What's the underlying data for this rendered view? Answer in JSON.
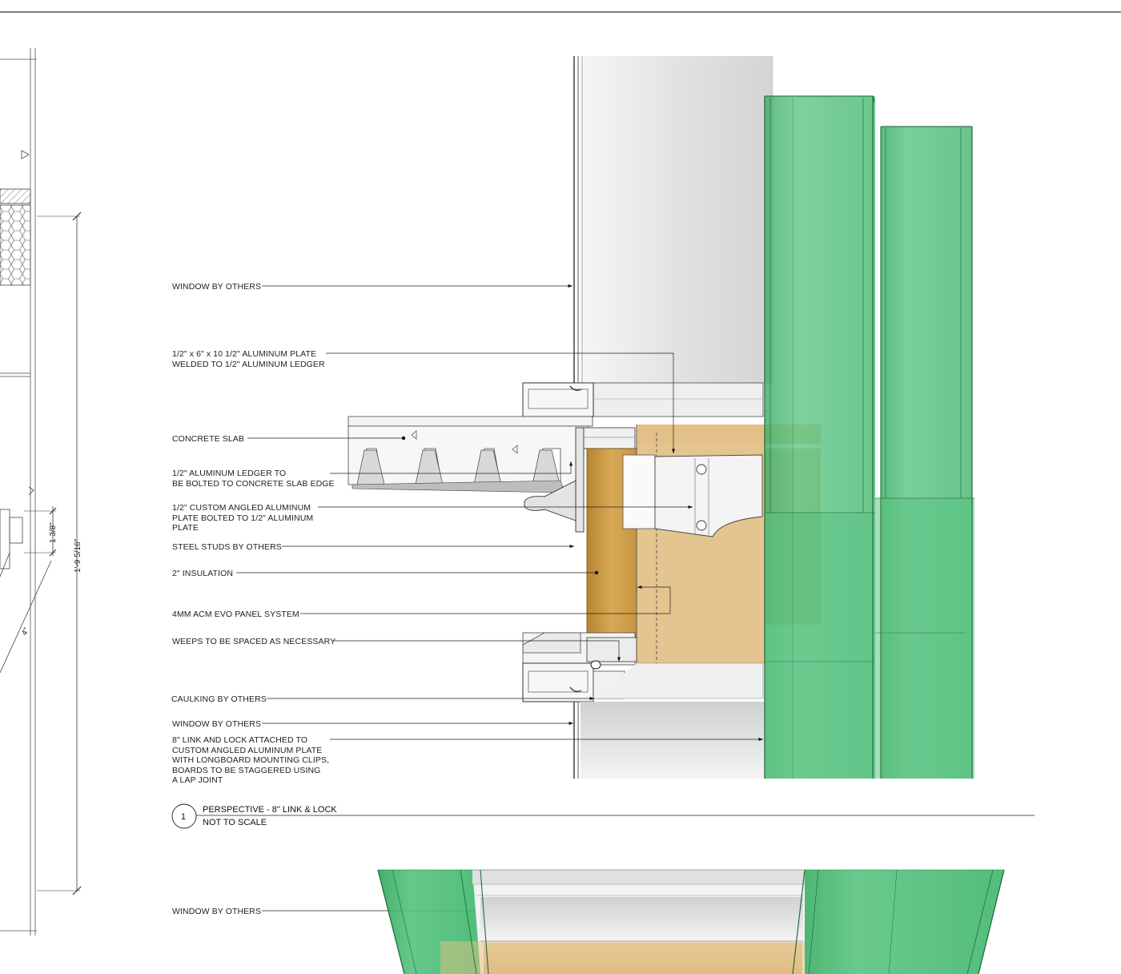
{
  "labels": {
    "window_top": "WINDOW BY OTHERS",
    "alum_plate": [
      "1/2\" x 6\" x 10 1/2\"  ALUMINUM PLATE",
      "WELDED TO 1/2\" ALUMINUM LEDGER"
    ],
    "concrete_slab": "CONCRETE SLAB",
    "alum_ledger": [
      "1/2\" ALUMINUM LEDGER TO",
      "BE BOLTED TO CONCRETE SLAB EDGE"
    ],
    "custom_plate": [
      "1/2\" CUSTOM ANGLED ALUMINUM",
      "PLATE BOLTED TO 1/2\" ALUMINUM",
      "PLATE"
    ],
    "steel_studs": "STEEL STUDS BY OTHERS",
    "insulation": "2\" INSULATION",
    "acm_panel": "4MM ACM EVO PANEL SYSTEM",
    "weeps": "WEEPS TO BE SPACED AS NECESSARY",
    "caulking": "CAULKING BY OTHERS",
    "window_mid": "WINDOW BY OTHERS",
    "link_lock": [
      "8\" LINK AND LOCK ATTACHED TO",
      "CUSTOM ANGLED ALUMINUM PLATE",
      "WITH LONGBOARD MOUNTING CLIPS,",
      "BOARDS TO BE STAGGERED USING",
      "A LAP JOINT"
    ],
    "window_bottom": "WINDOW BY OTHERS"
  },
  "dimensions": {
    "overall": "1'-9 5/16\"",
    "small": "1 3/8\"",
    "diag": "4\""
  },
  "title_block": {
    "number": "1",
    "title": "PERSPECTIVE - 8\" LINK & LOCK",
    "scale": "NOT TO SCALE"
  },
  "colors": {
    "green": "#3fb86a",
    "green_dark": "#1f7a41",
    "insulation": "#c99a4a",
    "glass": "#e8e8e8",
    "line": "#222222"
  }
}
